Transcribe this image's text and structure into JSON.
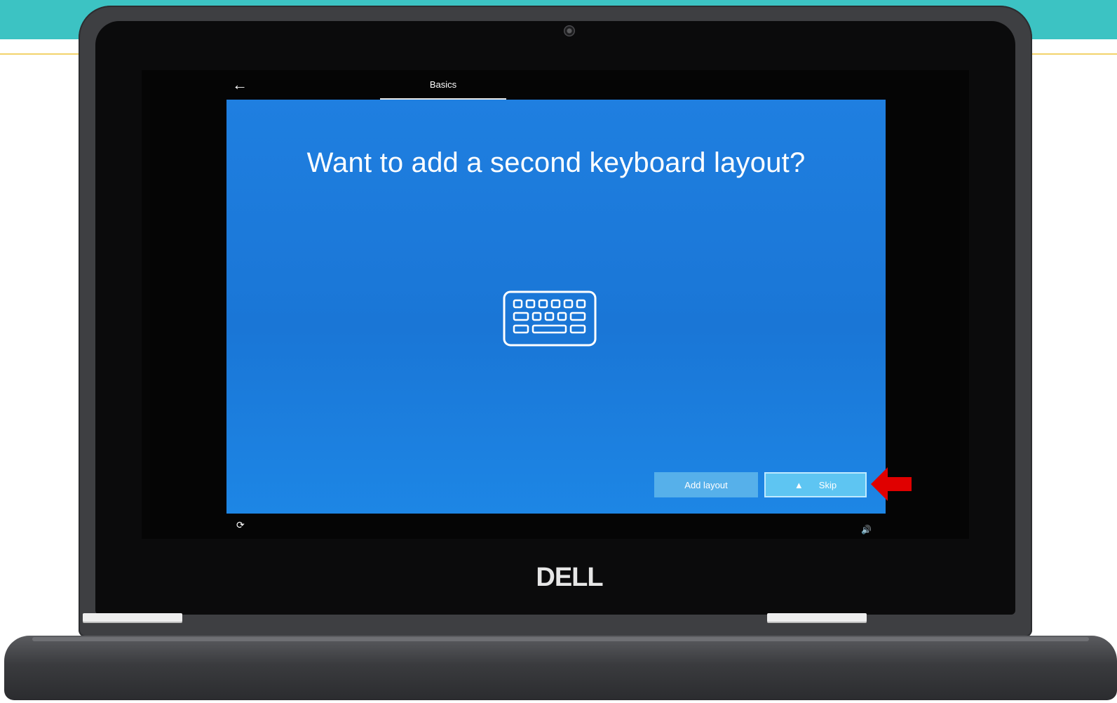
{
  "setup": {
    "tab_label": "Basics",
    "title": "Want to add a second keyboard layout?",
    "add_layout_label": "Add layout",
    "skip_label": "Skip"
  },
  "device": {
    "brand_logo": "DELL"
  },
  "icons": {
    "back": "back-arrow-icon",
    "keyboard": "keyboard-icon",
    "ease_of_access": "ease-of-access-icon",
    "volume": "volume-icon",
    "highlight": "red-arrow-icon"
  },
  "colors": {
    "oobe_blue": "#1a76d6",
    "button": "#56b0ea",
    "highlight_arrow": "#e00000",
    "teal_banner": "#3cc3c3"
  }
}
